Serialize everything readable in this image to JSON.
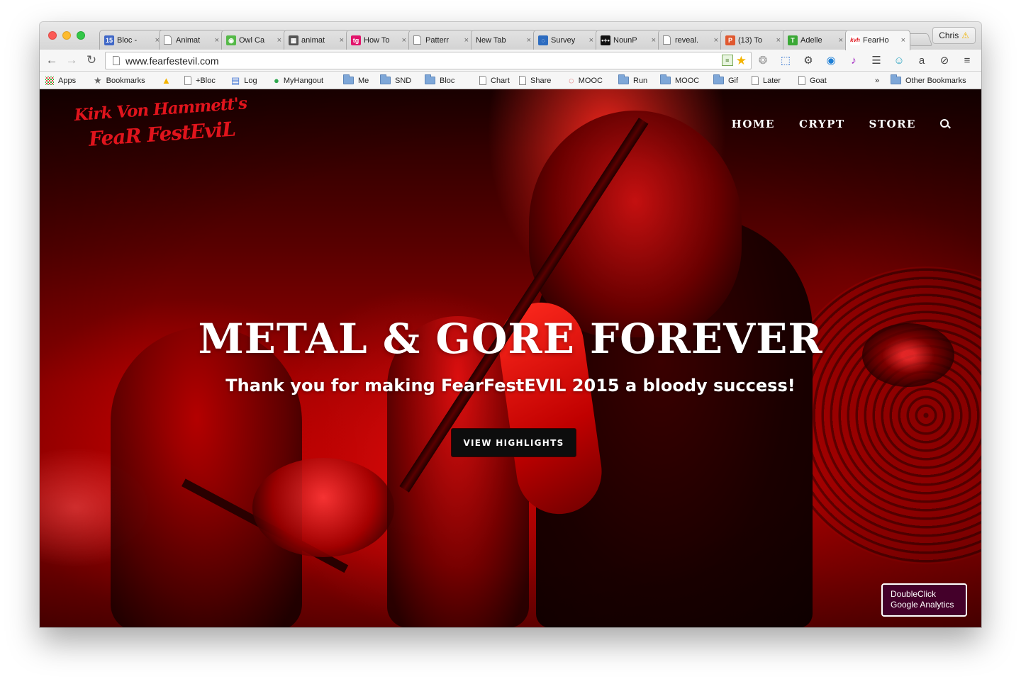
{
  "browser": {
    "tabs": [
      {
        "title": "Bloc -",
        "favicon": "calendar-15-icon",
        "fav_text": "15",
        "fav_color": "#3f67c7"
      },
      {
        "title": "Animat",
        "favicon": "page-icon"
      },
      {
        "title": "Owl Ca",
        "favicon": "owl-icon",
        "fav_text": "◉",
        "fav_color": "#55b948"
      },
      {
        "title": "animat",
        "favicon": "grid-icon",
        "fav_text": "▦",
        "fav_color": "#555555"
      },
      {
        "title": "How To",
        "favicon": "tg-icon",
        "fav_text": "tg",
        "fav_color": "#e2146b"
      },
      {
        "title": "Patterr",
        "favicon": "page-icon"
      },
      {
        "title": "New Tab",
        "favicon": "none"
      },
      {
        "title": "Survey",
        "favicon": "survey-icon",
        "fav_text": "◌",
        "fav_color": "#2d6cc0"
      },
      {
        "title": "NounP",
        "favicon": "noun-project-icon",
        "fav_text": "•+•",
        "fav_color": "#111111"
      },
      {
        "title": "reveal.",
        "favicon": "page-icon"
      },
      {
        "title": "(13) To",
        "favicon": "p-icon",
        "fav_text": "P",
        "fav_color": "#e0582f"
      },
      {
        "title": "Adelle",
        "favicon": "adelle-icon",
        "fav_text": "T",
        "fav_color": "#3aa835"
      },
      {
        "title": "FearHo",
        "favicon": "kvh-icon",
        "fav_text": "kvh",
        "fav_color": "#ffffff",
        "active": true
      }
    ],
    "profile_name": "Chris",
    "url": "www.fearfestevil.com",
    "bookmarks": [
      {
        "label": "Apps",
        "icon": "apps-icon"
      },
      {
        "label": "Bookmarks",
        "icon": "star-icon"
      },
      {
        "label": "",
        "icon": "drive-icon"
      },
      {
        "label": "+Bloc",
        "icon": "page-icon"
      },
      {
        "label": "Log",
        "icon": "doc-icon"
      },
      {
        "label": "MyHangout",
        "icon": "hangout-icon"
      },
      {
        "label": "Me",
        "icon": "folder-icon"
      },
      {
        "label": "SND",
        "icon": "folder-icon"
      },
      {
        "label": "Bloc",
        "icon": "folder-icon"
      },
      {
        "label": "Chart",
        "icon": "page-icon"
      },
      {
        "label": "Share",
        "icon": "page-icon"
      },
      {
        "label": "MOOC",
        "icon": "mooc-icon"
      },
      {
        "label": "Run",
        "icon": "folder-icon"
      },
      {
        "label": "MOOC",
        "icon": "folder-icon"
      },
      {
        "label": "Gif",
        "icon": "folder-icon"
      },
      {
        "label": "Later",
        "icon": "page-icon"
      },
      {
        "label": "Goat",
        "icon": "page-icon"
      }
    ],
    "bookmarks_overflow": "»",
    "other_bookmarks": "Other Bookmarks"
  },
  "site": {
    "logo_line1": "Kirk Von Hammett's",
    "logo_line2": "FeaR FestEviL",
    "nav": [
      {
        "label": "HOME"
      },
      {
        "label": "CRYPT"
      },
      {
        "label": "STORE"
      }
    ],
    "headline": "METAL & GORE FOREVER",
    "tagline": "Thank you for making FearFestEVIL 2015 a bloody success!",
    "cta_label": "VIEW HIGHLIGHTS",
    "badge_line1": "DoubleClick",
    "badge_line2": "Google Analytics"
  },
  "colors": {
    "accent": "#e0141c",
    "hero_red": "#c00000",
    "cta_bg": "#0d0d0d",
    "badge_bg": "#44002a"
  }
}
